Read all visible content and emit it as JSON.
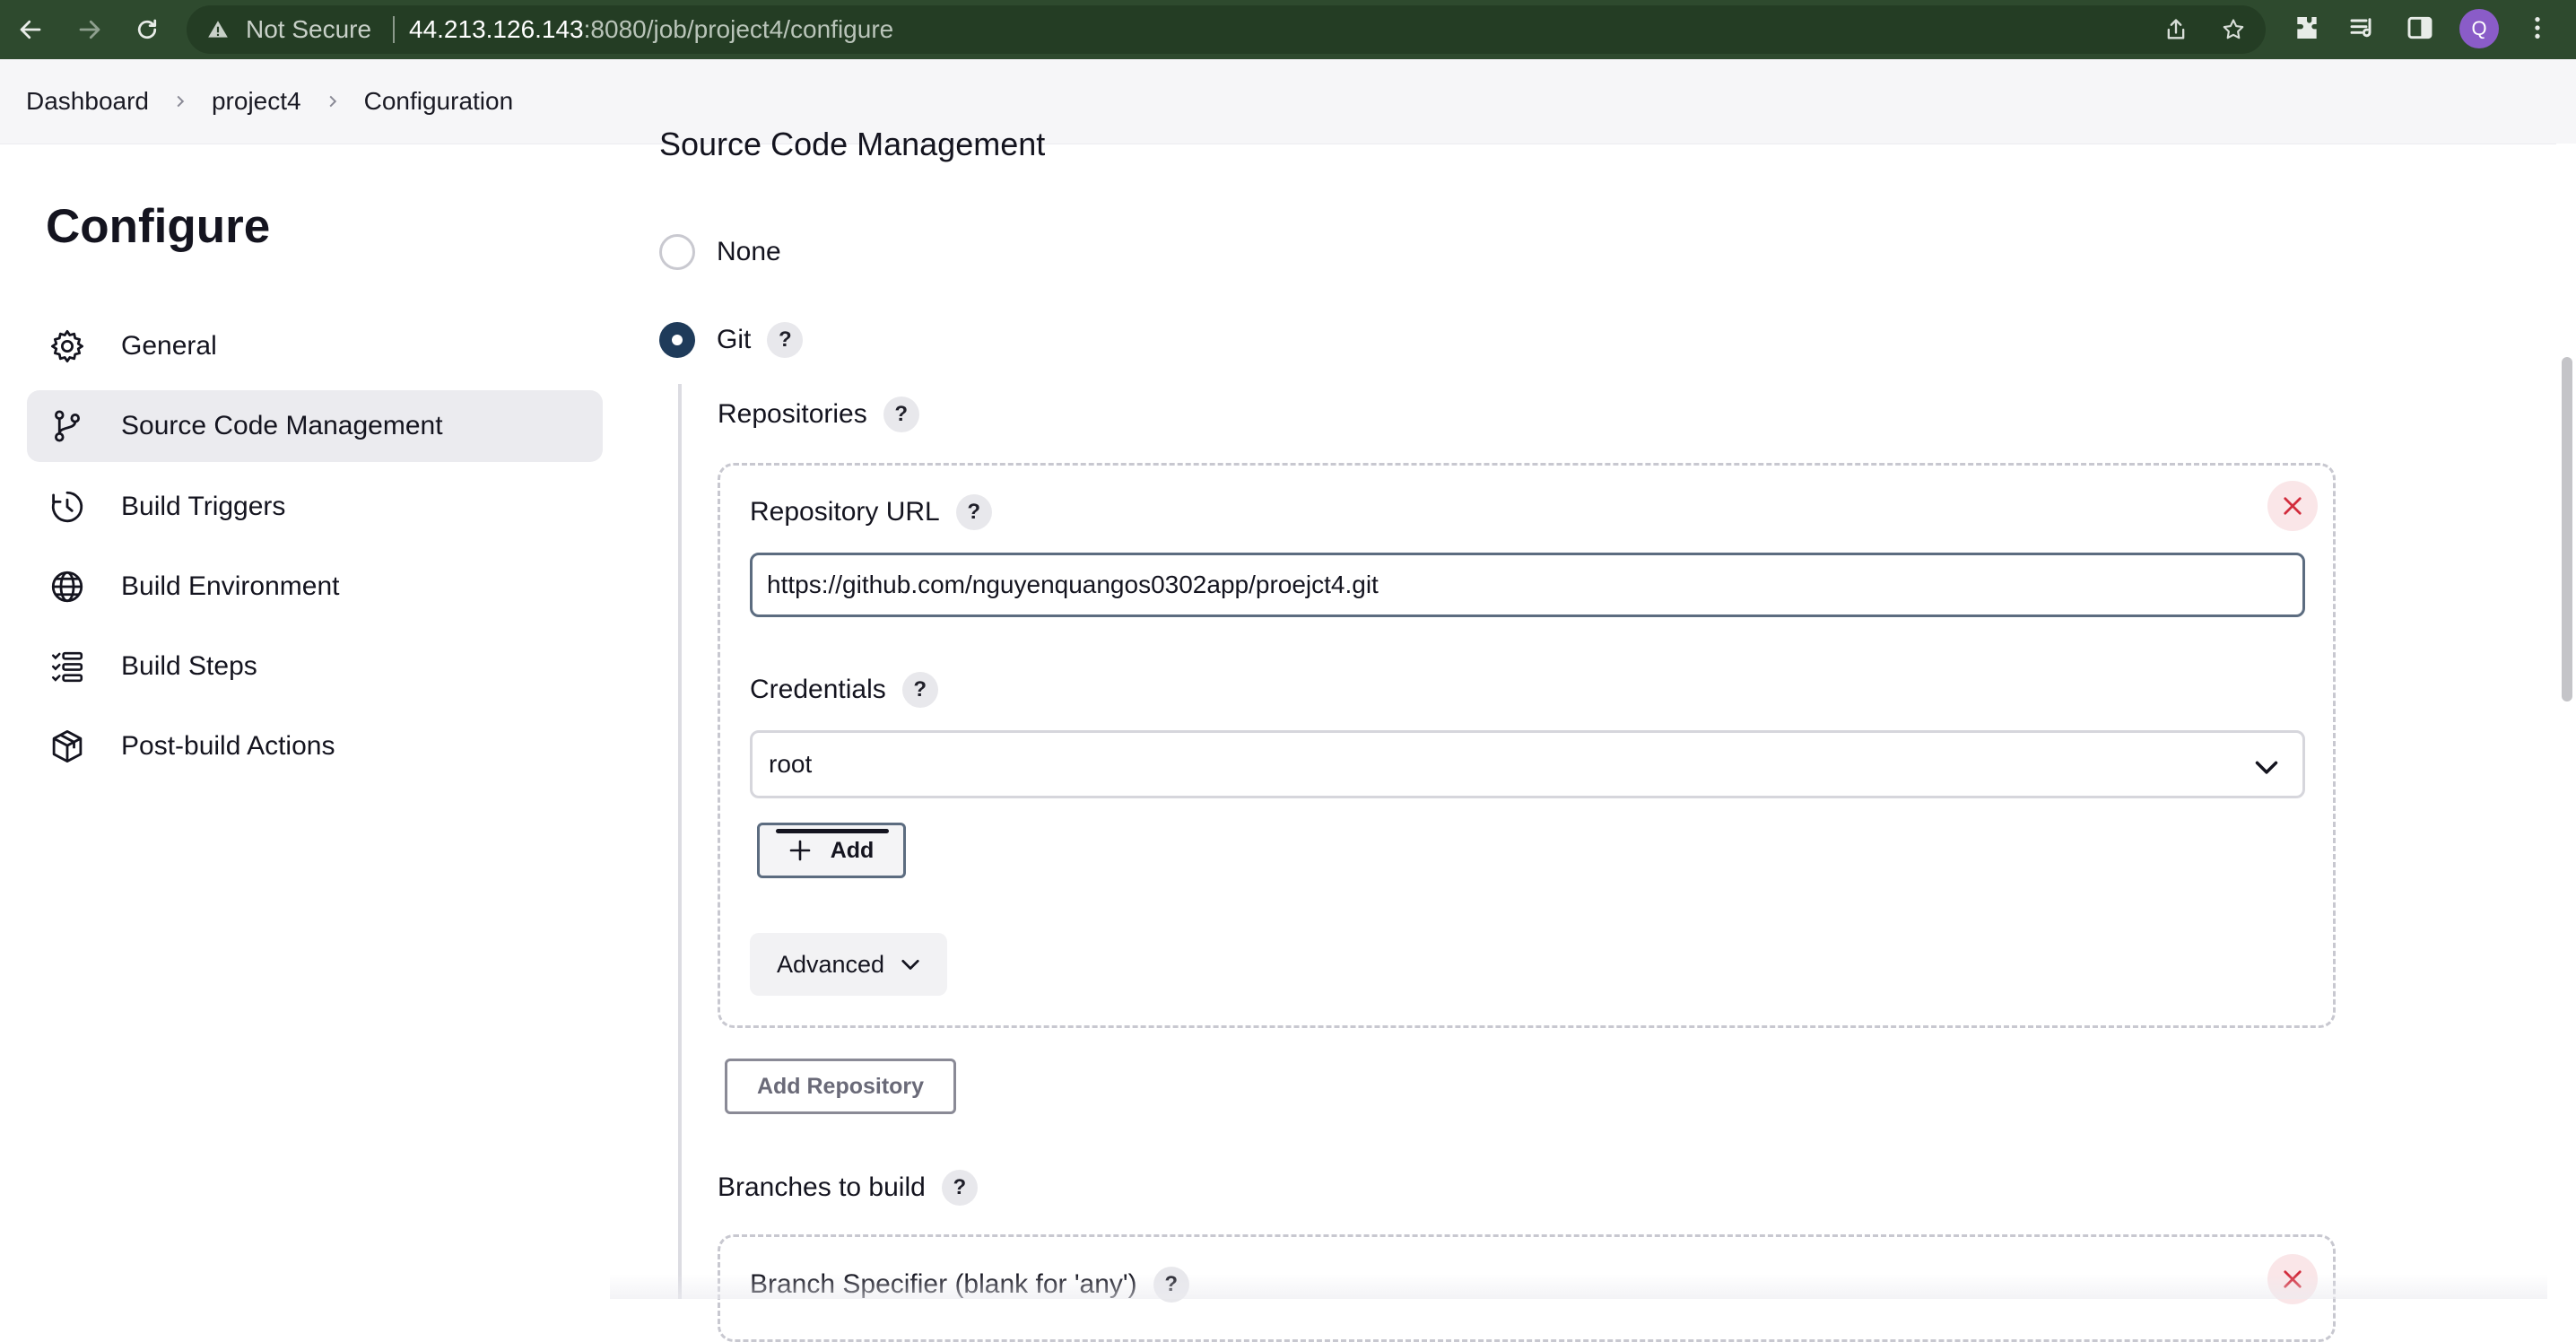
{
  "browser": {
    "security_label": "Not Secure",
    "url_host": "44.213.126.143",
    "url_rest": ":8080/job/project4/configure",
    "profile_initial": "Q"
  },
  "breadcrumb": [
    "Dashboard",
    "project4",
    "Configuration"
  ],
  "sidebar": {
    "title": "Configure",
    "items": [
      {
        "label": "General",
        "icon": "gear-icon"
      },
      {
        "label": "Source Code Management",
        "icon": "branch-icon",
        "active": true
      },
      {
        "label": "Build Triggers",
        "icon": "clock-icon"
      },
      {
        "label": "Build Environment",
        "icon": "globe-icon"
      },
      {
        "label": "Build Steps",
        "icon": "list-icon"
      },
      {
        "label": "Post-build Actions",
        "icon": "package-icon"
      }
    ]
  },
  "scm": {
    "section_title": "Source Code Management",
    "options": [
      {
        "label": "None",
        "selected": false
      },
      {
        "label": "Git",
        "selected": true
      }
    ],
    "repositories_label": "Repositories",
    "repo_url_label": "Repository URL",
    "repo_url_value": "https://github.com/nguyenquangos0302app/proejct4.git",
    "credentials_label": "Credentials",
    "credentials_value": "root",
    "add_label": "Add",
    "advanced_label": "Advanced",
    "add_repository_label": "Add Repository",
    "branches_label": "Branches to build",
    "branch_specifier_label": "Branch Specifier (blank for 'any')",
    "help_glyph": "?"
  },
  "colors": {
    "chrome_bg": "#2e4a2e",
    "radio_checked": "#1f3b5a",
    "close_red": "#d22c3c"
  }
}
